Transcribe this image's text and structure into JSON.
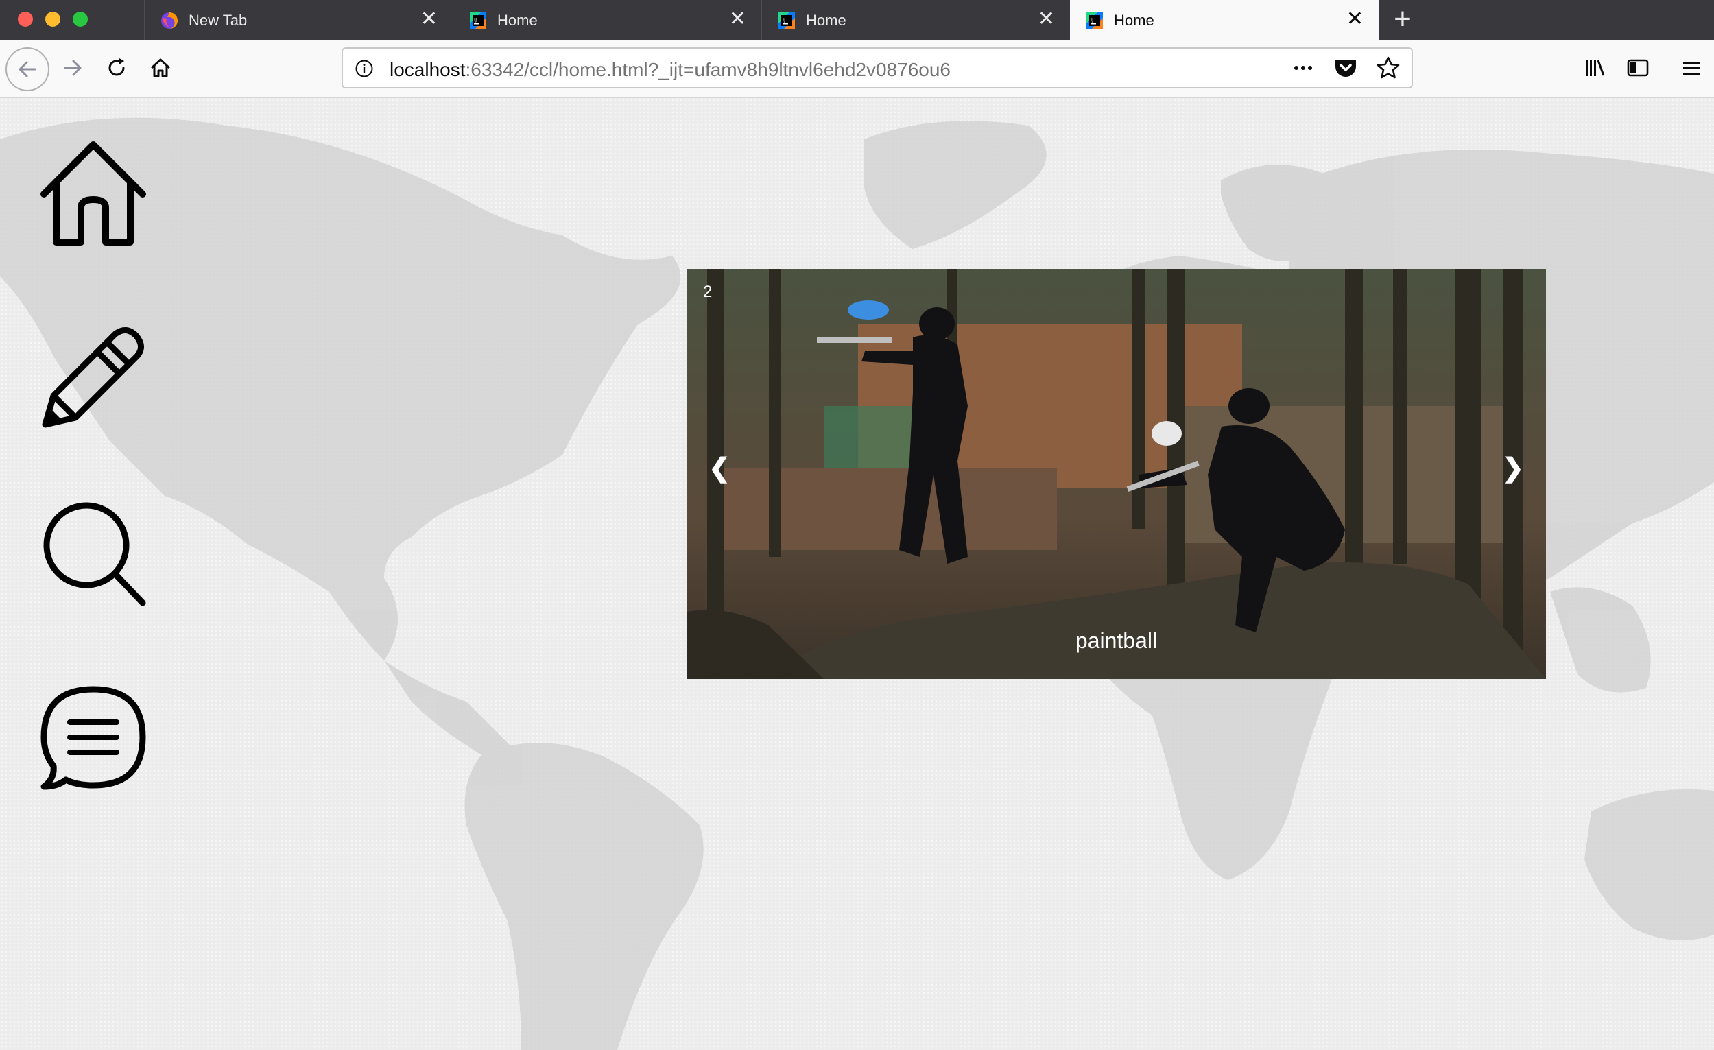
{
  "browser": {
    "tabs": [
      {
        "label": "New Tab",
        "icon": "firefox-icon",
        "active": false
      },
      {
        "label": "Home",
        "icon": "webstorm-icon",
        "active": false
      },
      {
        "label": "Home",
        "icon": "webstorm-icon",
        "active": false
      },
      {
        "label": "Home",
        "icon": "webstorm-icon",
        "active": true
      }
    ],
    "new_tab_label": "+",
    "url": {
      "host": "localhost",
      "rest": ":63342/ccl/home.html?_ijt=ufamv8h9ltnvl6ehd2v0876ou6"
    },
    "toolbar_icons": [
      "back-icon",
      "forward-icon",
      "reload-icon",
      "home-icon",
      "page-actions-icon",
      "pocket-icon",
      "bookmark-star-icon",
      "library-icon",
      "sidebar-icon",
      "menu-icon"
    ]
  },
  "sidenav": {
    "items": [
      {
        "icon": "home-icon"
      },
      {
        "icon": "pencil-icon"
      },
      {
        "icon": "search-icon"
      },
      {
        "icon": "chat-icon"
      }
    ]
  },
  "carousel": {
    "slide_number": "2",
    "caption": "paintball",
    "prev_label": "❮",
    "next_label": "❯"
  },
  "colors": {
    "tabstrip": "#38383d",
    "toolbar": "#f9f9fa",
    "page_background": "#ececec",
    "map_land": "#d3d3d3"
  }
}
